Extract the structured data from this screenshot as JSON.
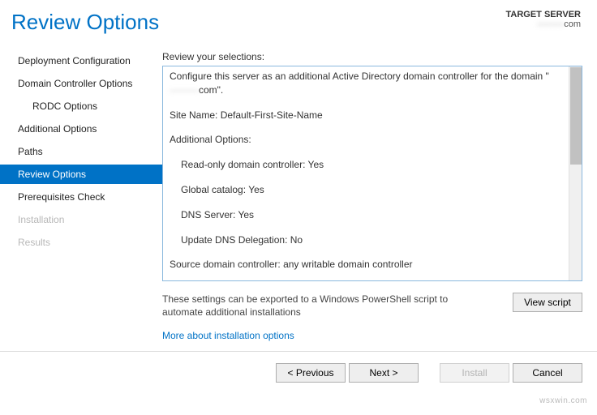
{
  "header": {
    "title": "Review Options",
    "target_label": "TARGET SERVER",
    "target_host_blur": "———",
    "target_host_suffix": "com"
  },
  "sidebar": {
    "items": [
      {
        "label": "Deployment Configuration",
        "indent": false,
        "selected": false,
        "disabled": false
      },
      {
        "label": "Domain Controller Options",
        "indent": false,
        "selected": false,
        "disabled": false
      },
      {
        "label": "RODC Options",
        "indent": true,
        "selected": false,
        "disabled": false
      },
      {
        "label": "Additional Options",
        "indent": false,
        "selected": false,
        "disabled": false
      },
      {
        "label": "Paths",
        "indent": false,
        "selected": false,
        "disabled": false
      },
      {
        "label": "Review Options",
        "indent": false,
        "selected": true,
        "disabled": false
      },
      {
        "label": "Prerequisites Check",
        "indent": false,
        "selected": false,
        "disabled": false
      },
      {
        "label": "Installation",
        "indent": false,
        "selected": false,
        "disabled": true
      },
      {
        "label": "Results",
        "indent": false,
        "selected": false,
        "disabled": true
      }
    ]
  },
  "main": {
    "review_label": "Review your selections:",
    "line_configure_prefix": "Configure this server as an additional Active Directory domain controller for the domain \"",
    "line_configure_blur": "———",
    "line_configure_suffix": "com\".",
    "site_name_label": "Site Name:",
    "site_name_value": "Default-First-Site-Name",
    "additional_options_label": "Additional Options:",
    "rodc_label": "Read-only domain controller:",
    "rodc_value": "Yes",
    "gc_label": "Global catalog:",
    "gc_value": "Yes",
    "dns_label": "DNS Server:",
    "dns_value": "Yes",
    "delegation_label": "Update DNS Delegation:",
    "delegation_value": "No",
    "source_dc_label": "Source domain controller:",
    "source_dc_value": "any writable domain controller",
    "export_text": "These settings can be exported to a Windows PowerShell script to automate additional installations",
    "view_script_btn": "View script",
    "more_link": "More about installation options"
  },
  "footer": {
    "previous": "< Previous",
    "next": "Next >",
    "install": "Install",
    "cancel": "Cancel"
  },
  "watermark": "wsxwin.com"
}
